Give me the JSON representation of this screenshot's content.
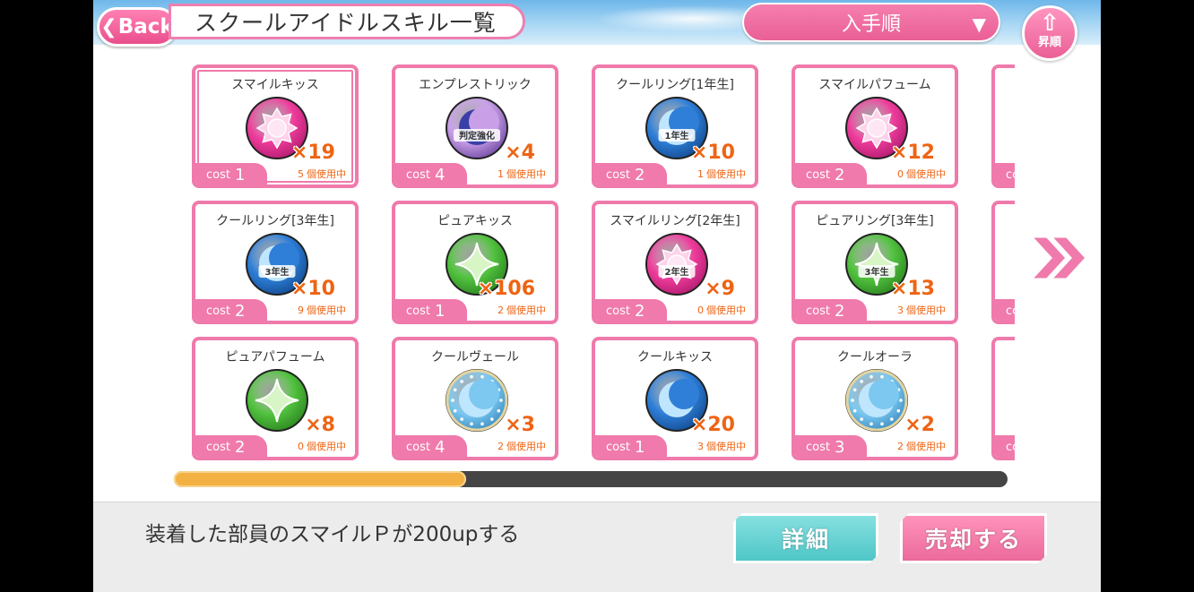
{
  "header": {
    "back_label": "Back",
    "title": "スクールアイドルスキル一覧",
    "sort_label": "入手順",
    "order_label": "昇順"
  },
  "colors": {
    "pink_accent": "#ef7aab",
    "orange_text": "#ee6413",
    "scroll_thumb": "#f3b143",
    "smile": "#ef3d9c",
    "pure": "#52c23f",
    "cool": "#2f7fd8"
  },
  "cards": [
    {
      "name": "スマイルキッス",
      "count": "×19",
      "cost_label": "cost",
      "cost": "1",
      "used": "5",
      "used_label": "個使用中",
      "icon": "sun-icon",
      "attr": "smile",
      "badge": "",
      "selected": true
    },
    {
      "name": "クールリング[3年生]",
      "count": "×10",
      "cost_label": "cost",
      "cost": "2",
      "used": "9",
      "used_label": "個使用中",
      "icon": "moon-icon",
      "attr": "cool",
      "badge": "3年生",
      "selected": false
    },
    {
      "name": "ピュアパフューム",
      "count": "×8",
      "cost_label": "cost",
      "cost": "2",
      "used": "0",
      "used_label": "個使用中",
      "icon": "sparkle-icon",
      "attr": "pure",
      "badge": "",
      "selected": false
    },
    {
      "name": "エンプレストリック",
      "count": "×4",
      "cost_label": "cost",
      "cost": "4",
      "used": "1",
      "used_label": "個使用中",
      "icon": "moon-icon",
      "attr": "special",
      "badge": "判定強化",
      "selected": false
    },
    {
      "name": "ピュアキッス",
      "count": "×106",
      "cost_label": "cost",
      "cost": "1",
      "used": "2",
      "used_label": "個使用中",
      "icon": "sparkle-icon",
      "attr": "pure",
      "badge": "",
      "selected": false
    },
    {
      "name": "クールヴェール",
      "count": "×3",
      "cost_label": "cost",
      "cost": "4",
      "used": "2",
      "used_label": "個使用中",
      "icon": "moon-icon",
      "attr": "coolveil",
      "badge": "",
      "selected": false
    },
    {
      "name": "クールリング[1年生]",
      "count": "×10",
      "cost_label": "cost",
      "cost": "2",
      "used": "1",
      "used_label": "個使用中",
      "icon": "moon-icon",
      "attr": "cool",
      "badge": "1年生",
      "selected": false
    },
    {
      "name": "スマイルリング[2年生]",
      "count": "×9",
      "cost_label": "cost",
      "cost": "2",
      "used": "0",
      "used_label": "個使用中",
      "icon": "sun-icon",
      "attr": "smile",
      "badge": "2年生",
      "selected": false
    },
    {
      "name": "クールキッス",
      "count": "×20",
      "cost_label": "cost",
      "cost": "1",
      "used": "3",
      "used_label": "個使用中",
      "icon": "moon-icon",
      "attr": "cool",
      "badge": "",
      "selected": false
    },
    {
      "name": "スマイルパフューム",
      "count": "×12",
      "cost_label": "cost",
      "cost": "2",
      "used": "0",
      "used_label": "個使用中",
      "icon": "sun-icon",
      "attr": "smile",
      "badge": "",
      "selected": false
    },
    {
      "name": "ピュアリング[3年生]",
      "count": "×13",
      "cost_label": "cost",
      "cost": "2",
      "used": "3",
      "used_label": "個使用中",
      "icon": "sparkle-icon",
      "attr": "pure",
      "badge": "3年生",
      "selected": false
    },
    {
      "name": "クールオーラ",
      "count": "×2",
      "cost_label": "cost",
      "cost": "3",
      "used": "2",
      "used_label": "個使用中",
      "icon": "moon-icon",
      "attr": "coolveil",
      "badge": "",
      "selected": false
    },
    {
      "name": "ス",
      "count": "",
      "cost_label": "co",
      "cost": "",
      "used": "",
      "used_label": "",
      "icon": "",
      "attr": "",
      "badge": "",
      "selected": false
    },
    {
      "name": "",
      "count": "",
      "cost_label": "co",
      "cost": "",
      "used": "",
      "used_label": "",
      "icon": "",
      "attr": "",
      "badge": "",
      "selected": false
    },
    {
      "name": "ヒ",
      "count": "",
      "cost_label": "co",
      "cost": "",
      "used": "",
      "used_label": "",
      "icon": "",
      "attr": "",
      "badge": "",
      "selected": false
    }
  ],
  "scroll": {
    "position_fraction": 0.35
  },
  "footer": {
    "description": "装着した部員のスマイルＰが200upする",
    "detail_label": "詳細",
    "sell_label": "売却する"
  }
}
